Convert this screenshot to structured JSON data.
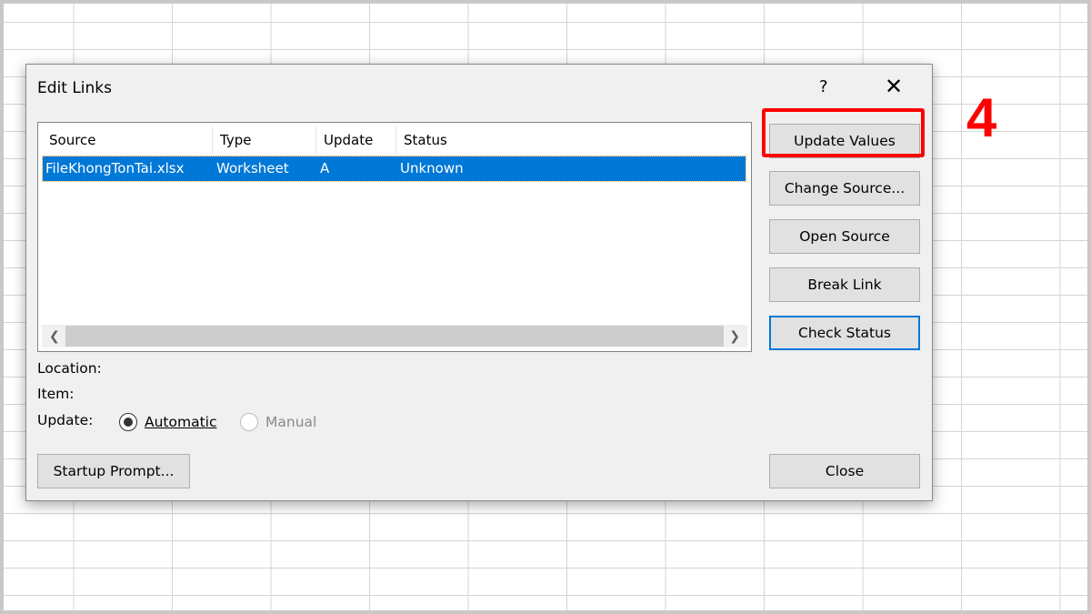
{
  "dialog": {
    "title": "Edit Links",
    "help": "?",
    "close_glyph": "✕"
  },
  "table": {
    "columns": [
      "Source",
      "Type",
      "Update",
      "Status"
    ],
    "rows": [
      {
        "source": "FileKhongTonTai.xlsx",
        "type": "Worksheet",
        "update": "A",
        "status": "Unknown"
      }
    ]
  },
  "buttons": {
    "update_values": "Update Values",
    "change_source": "Change Source...",
    "open_source": "Open Source",
    "break_link": "Break Link",
    "check_status": "Check Status",
    "close": "Close",
    "startup_prompt": "Startup Prompt..."
  },
  "labels": {
    "location": "Location:",
    "item": "Item:",
    "update": "Update:",
    "automatic": "Automatic",
    "manual": "Manual"
  },
  "annotation": {
    "step": "4",
    "color": "#ff0000"
  }
}
